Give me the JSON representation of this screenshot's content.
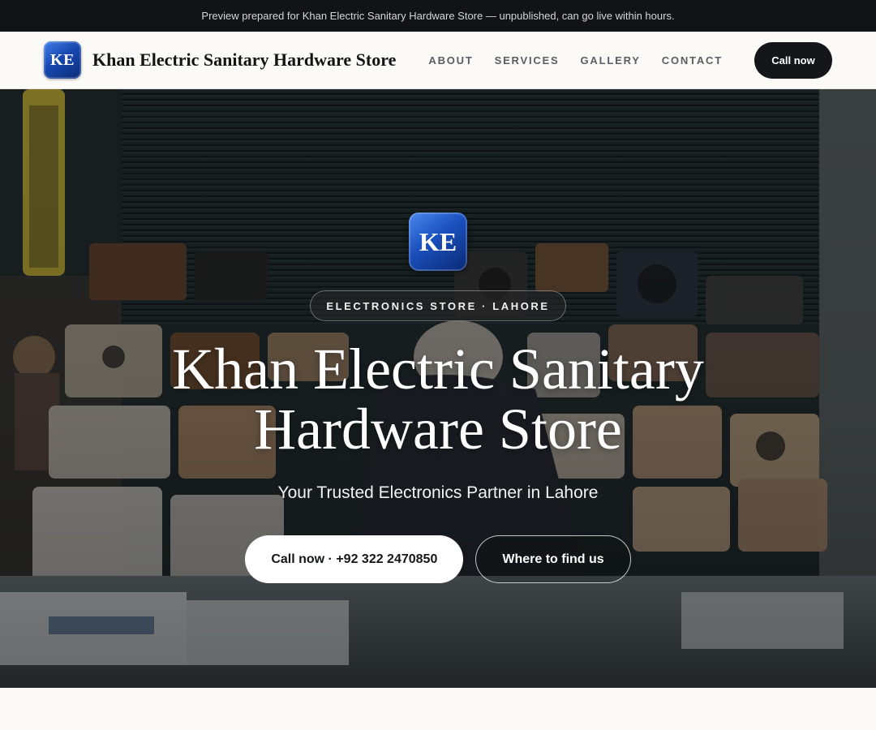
{
  "preview_banner": {
    "text": "Preview prepared for Khan Electric Sanitary Hardware Store — unpublished, can go live within hours."
  },
  "header": {
    "logo_initials": "KE",
    "brand_name": "Khan Electric Sanitary Hardware Store",
    "nav": [
      {
        "label": "ABOUT"
      },
      {
        "label": "SERVICES"
      },
      {
        "label": "GALLERY"
      },
      {
        "label": "CONTACT"
      }
    ],
    "call_label": "Call now"
  },
  "hero": {
    "logo_initials": "KE",
    "tag": "ELECTRONICS STORE · LAHORE",
    "title": "Khan Electric Sanitary Hardware Store",
    "subtitle": "Your Trusted Electronics Partner in Lahore",
    "primary_cta": "Call now · +92 322 2470850",
    "secondary_cta": "Where to find us",
    "background_image": "electronics-shop-photo"
  },
  "colors": {
    "banner_bg": "#121316",
    "header_bg": "#fbfaf7",
    "dark_button": "#15161a",
    "logo_blue": "#1848b0"
  }
}
